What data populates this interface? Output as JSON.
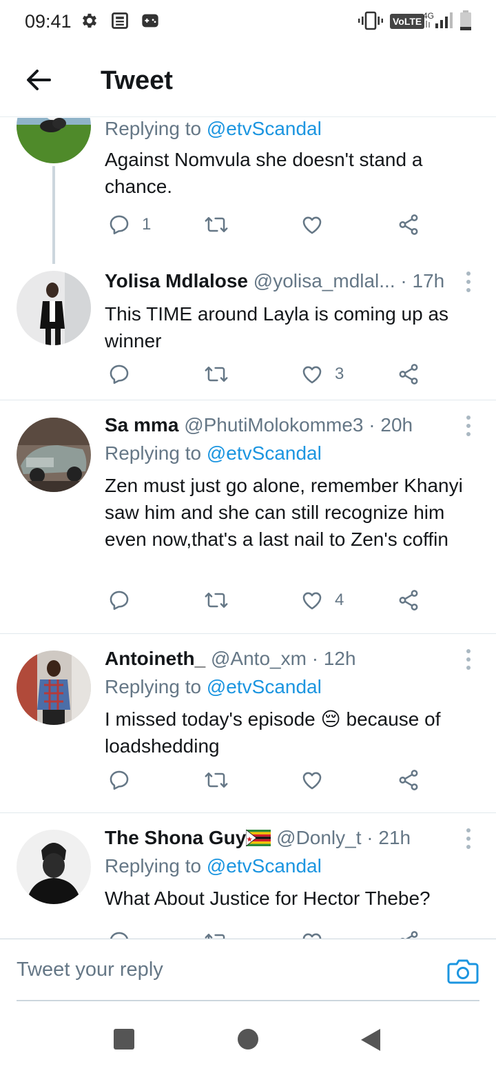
{
  "status_bar": {
    "time": "09:41",
    "left_icons": [
      "gear-icon",
      "news-icon",
      "game-icon"
    ],
    "volte_label": "VoLTE",
    "network_label": "4G"
  },
  "header": {
    "title": "Tweet"
  },
  "tweets": [
    {
      "replying_prefix": "Replying to ",
      "replying_handle": "@etvScandal",
      "text": "Against Nomvula she doesn't stand a chance.",
      "reply_count": "1",
      "retweet_count": "",
      "like_count": ""
    },
    {
      "name": "Yolisa Mdlalose",
      "handle": "@yolisa_mdlal...",
      "time": " · 17h",
      "text": "This TIME around Layla is coming up as winner",
      "reply_count": "",
      "retweet_count": "",
      "like_count": "3"
    },
    {
      "name": "Sa mma",
      "handle": "@PhutiMolokomme3",
      "time": " · 20h",
      "replying_prefix": "Replying to ",
      "replying_handle": "@etvScandal",
      "text": "Zen must just go alone, remember Khanyi saw him and she can still recognize him even now,that's a last nail to Zen's coffin",
      "reply_count": "",
      "retweet_count": "",
      "like_count": "4"
    },
    {
      "name": "Antoineth_",
      "handle": "@Anto_xm",
      "time": " · 12h",
      "replying_prefix": "Replying to ",
      "replying_handle": "@etvScandal",
      "text_before": "I missed today's episode ",
      "emoji": "😔",
      "text_after": " because of loadshedding",
      "reply_count": "",
      "retweet_count": "",
      "like_count": ""
    },
    {
      "name": "The Shona Guy",
      "handle": "@Donly_t",
      "time": " · 21h",
      "replying_prefix": "Replying to ",
      "replying_handle": "@etvScandal",
      "text": "What About Justice for Hector Thebe?"
    }
  ],
  "reply_bar": {
    "placeholder": "Tweet your reply"
  },
  "colors": {
    "accent": "#1b95e0",
    "secondary_text": "#657786",
    "primary_text": "#14171a",
    "divider": "#e1e8ed"
  }
}
